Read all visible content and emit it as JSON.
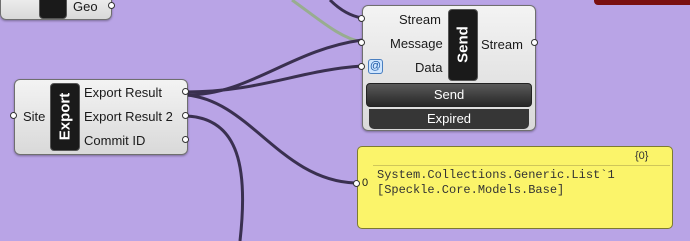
{
  "top_component": {
    "label": "Geo"
  },
  "export_component": {
    "title": "Export",
    "input_label": "Site",
    "outputs": [
      "Export Result",
      "Export Result 2",
      "Commit ID"
    ]
  },
  "send_component": {
    "title": "Send",
    "inputs": [
      "Stream",
      "Message",
      "Data"
    ],
    "output_label": "Stream",
    "button_label": "Send",
    "status": "Expired",
    "data_badge": "@"
  },
  "panel": {
    "path_tag": "{0}",
    "index": "0",
    "lines": [
      "System.Collections.Generic.List`1",
      "[Speckle.Core.Models.Base]"
    ]
  },
  "colors": {
    "canvas": "#b9a4e6",
    "wire": "#3a3050",
    "wire_light": "#9ab09a",
    "panel_bg": "#fbf46a"
  }
}
